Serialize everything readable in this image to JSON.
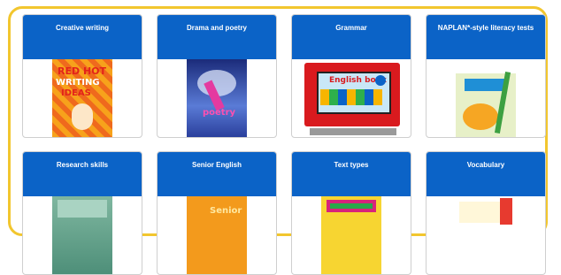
{
  "cards": [
    {
      "title": "Creative writing"
    },
    {
      "title": "Drama and poetry"
    },
    {
      "title": "Grammar"
    },
    {
      "title": "NAPLAN*-style literacy tests"
    },
    {
      "title": "Research skills"
    },
    {
      "title": "Senior English"
    },
    {
      "title": "Text types"
    },
    {
      "title": "Vocabulary"
    }
  ],
  "colors": {
    "header": "#0b63c7",
    "frame": "#f2c62e"
  }
}
